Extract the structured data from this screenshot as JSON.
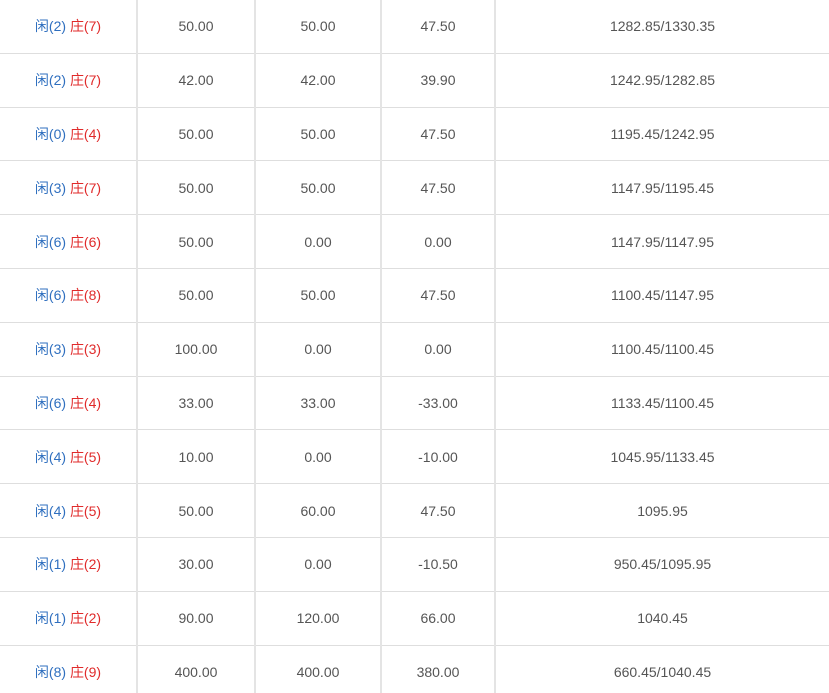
{
  "colors": {
    "player": "#2f6fbf",
    "banker": "#e02b2b",
    "bet": "#3a7fd6",
    "negative": "#e02b2b",
    "text": "#555555"
  },
  "rows": [
    {
      "player": "闲(2)",
      "banker": "庄(7)",
      "bet": "50.00",
      "valid": "50.00",
      "win": "47.50",
      "win_negative": false,
      "balance": "1282.85/1330.35"
    },
    {
      "player": "闲(2)",
      "banker": "庄(7)",
      "bet": "42.00",
      "valid": "42.00",
      "win": "39.90",
      "win_negative": false,
      "balance": "1242.95/1282.85"
    },
    {
      "player": "闲(0)",
      "banker": "庄(4)",
      "bet": "50.00",
      "valid": "50.00",
      "win": "47.50",
      "win_negative": false,
      "balance": "1195.45/1242.95"
    },
    {
      "player": "闲(3)",
      "banker": "庄(7)",
      "bet": "50.00",
      "valid": "50.00",
      "win": "47.50",
      "win_negative": false,
      "balance": "1147.95/1195.45"
    },
    {
      "player": "闲(6)",
      "banker": "庄(6)",
      "bet": "50.00",
      "valid": "0.00",
      "win": "0.00",
      "win_negative": false,
      "balance": "1147.95/1147.95"
    },
    {
      "player": "闲(6)",
      "banker": "庄(8)",
      "bet": "50.00",
      "valid": "50.00",
      "win": "47.50",
      "win_negative": false,
      "balance": "1100.45/1147.95"
    },
    {
      "player": "闲(3)",
      "banker": "庄(3)",
      "bet": "100.00",
      "valid": "0.00",
      "win": "0.00",
      "win_negative": false,
      "balance": "1100.45/1100.45"
    },
    {
      "player": "闲(6)",
      "banker": "庄(4)",
      "bet": "33.00",
      "valid": "33.00",
      "win": "-33.00",
      "win_negative": true,
      "balance": "1133.45/1100.45"
    },
    {
      "player": "闲(4)",
      "banker": "庄(5)",
      "bet": "10.00",
      "valid": "0.00",
      "win": "-10.00",
      "win_negative": true,
      "balance": "1045.95/1133.45"
    },
    {
      "player": "闲(4)",
      "banker": "庄(5)",
      "bet": "50.00",
      "valid": "60.00",
      "win": "47.50",
      "win_negative": false,
      "balance": "1095.95"
    },
    {
      "player": "闲(1)",
      "banker": "庄(2)",
      "bet": "30.00",
      "valid": "0.00",
      "win": "-10.50",
      "win_negative": true,
      "balance": "950.45/1095.95"
    },
    {
      "player": "闲(1)",
      "banker": "庄(2)",
      "bet": "90.00",
      "valid": "120.00",
      "win": "66.00",
      "win_negative": false,
      "balance": "1040.45"
    },
    {
      "player": "闲(8)",
      "banker": "庄(9)",
      "bet": "400.00",
      "valid": "400.00",
      "win": "380.00",
      "win_negative": false,
      "balance": "660.45/1040.45"
    }
  ]
}
